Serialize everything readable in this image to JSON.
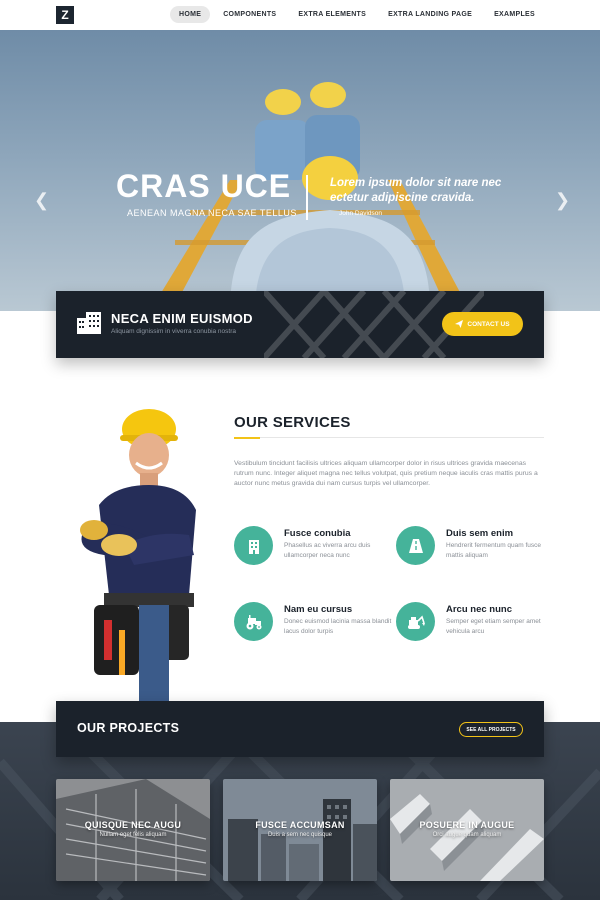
{
  "nav": {
    "logo": "Z",
    "items": [
      "HOME",
      "COMPONENTS",
      "EXTRA ELEMENTS",
      "EXTRA LANDING PAGE",
      "EXAMPLES"
    ]
  },
  "hero": {
    "title": "CRAS UCE",
    "subtitle": "AENEAN MAGNA NECA SAE TELLUS",
    "quote": "Lorem ipsum dolor sit nare nec ectetur adipiscine cravida.",
    "author": "John Davidson",
    "prev_icon": "chevron-left-icon",
    "next_icon": "chevron-right-icon"
  },
  "cta": {
    "icon": "buildings-icon",
    "title": "NECA ENIM EUISMOD",
    "subtitle": "Aliquam dignissim in viverra conubia nostra",
    "button": "CONTACT US",
    "button_icon": "paper-plane-icon"
  },
  "services": {
    "title": "OUR SERVICES",
    "description": "Vestibulum tincidunt facilisis ultrices aliquam ullamcorper dolor in risus ultrices gravida maecenas rutrum nunc. Integer aliquet magna nec tellus volutpat, quis pretium neque iaculis cras mattis purus a auctor nunc metus gravida dui nam cursus turpis vel ullamcorper.",
    "items": [
      {
        "title": "Fusce conubia",
        "text": "Phasellus ac viverra arcu duis ullamcorper neca nunc",
        "icon": "building-icon"
      },
      {
        "title": "Duis sem enim",
        "text": "Hendrerit fermentum quam fusce mattis aliquam",
        "icon": "road-icon"
      },
      {
        "title": "Nam eu cursus",
        "text": "Donec euismod lacinia massa blandit lacus dolor turpis",
        "icon": "tractor-icon"
      },
      {
        "title": "Arcu nec nunc",
        "text": "Semper eget etiam semper amet vehicula arcu",
        "icon": "excavator-icon"
      }
    ]
  },
  "projects": {
    "title": "OUR PROJECTS",
    "button": "SEE ALL PROJECTS",
    "cards": [
      {
        "title": "QUISQUE NEC AUGU",
        "subtitle": "Nullam eget felis aliquam"
      },
      {
        "title": "FUSCE ACCUMSAN",
        "subtitle": "Duis a sem nec quisque"
      },
      {
        "title": "POSUERE IN AUGUE",
        "subtitle": "Orci augue quam aliquam"
      }
    ]
  },
  "colors": {
    "accent": "#f2c318",
    "teal": "#45b39a",
    "dark": "#1b222b"
  }
}
